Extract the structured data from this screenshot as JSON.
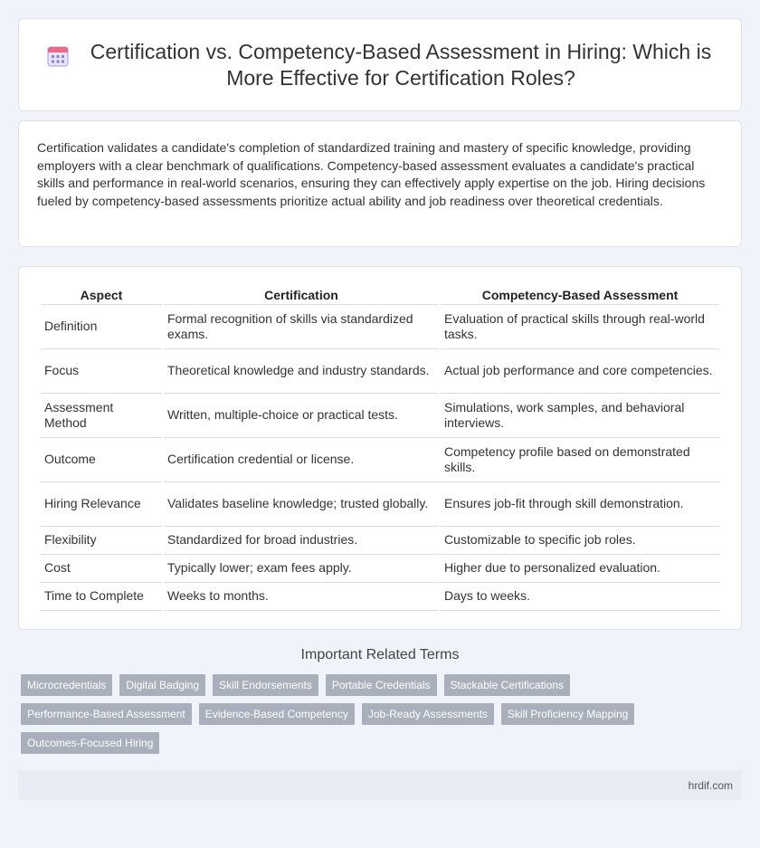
{
  "header": {
    "icon": "calendar-icon",
    "title": "Certification vs. Competency-Based Assessment in Hiring: Which is More Effective for Certification Roles?"
  },
  "intro": {
    "text": "Certification validates a candidate's completion of standardized training and mastery of specific knowledge, providing employers with a clear benchmark of qualifications. Competency-based assessment evaluates a candidate's practical skills and performance in real-world scenarios, ensuring they can effectively apply expertise on the job. Hiring decisions fueled by competency-based assessments prioritize actual ability and job readiness over theoretical credentials."
  },
  "table": {
    "headers": [
      "Aspect",
      "Certification",
      "Competency-Based Assessment"
    ],
    "rows": [
      [
        "Definition",
        "Formal recognition of skills via standardized exams.",
        "Evaluation of practical skills through real-world tasks."
      ],
      [
        "Focus",
        "Theoretical knowledge and industry standards.",
        "Actual job performance and core competencies."
      ],
      [
        "Assessment Method",
        "Written, multiple-choice or practical tests.",
        "Simulations, work samples, and behavioral interviews."
      ],
      [
        "Outcome",
        "Certification credential or license.",
        "Competency profile based on demonstrated skills."
      ],
      [
        "Hiring Relevance",
        "Validates baseline knowledge; trusted globally.",
        "Ensures job-fit through skill demonstration."
      ],
      [
        "Flexibility",
        "Standardized for broad industries.",
        "Customizable to specific job roles."
      ],
      [
        "Cost",
        "Typically lower; exam fees apply.",
        "Higher due to personalized evaluation."
      ],
      [
        "Time to Complete",
        "Weeks to months.",
        "Days to weeks."
      ]
    ]
  },
  "related": {
    "title": "Important Related Terms",
    "tags": [
      "Microcredentials",
      "Digital Badging",
      "Skill Endorsements",
      "Portable Credentials",
      "Stackable Certifications",
      "Performance-Based Assessment",
      "Evidence-Based Competency",
      "Job-Ready Assessments",
      "Skill Proficiency Mapping",
      "Outcomes-Focused Hiring"
    ]
  },
  "footer": {
    "site": "hrdif.com"
  }
}
